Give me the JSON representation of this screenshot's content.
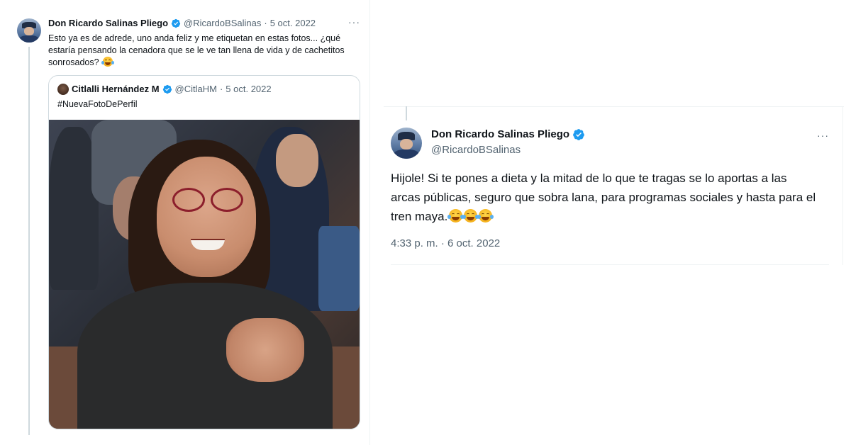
{
  "left_tweet": {
    "author_name": "Don Ricardo Salinas Pliego",
    "handle": "@RicardoBSalinas",
    "separator": "·",
    "date": "5 oct. 2022",
    "more_label": "···",
    "text": "Esto ya es de adrede, uno anda feliz y me etiquetan en estas fotos... ¿qué estaría pensando la cenadora que se le ve tan llena de vida y de cachetitos sonrosados?",
    "emoji": "face-with-tears-of-joy",
    "quoted_tweet": {
      "author_name": "Citlalli Hernández M",
      "handle": "@CitlaHM",
      "separator": "·",
      "date": "5 oct. 2022",
      "text": "#NuevaFotoDePerfil",
      "photo": "woman-smiling-red-glasses"
    }
  },
  "right_tweet": {
    "author_name": "Don Ricardo Salinas Pliego",
    "handle": "@RicardoBSalinas",
    "more_label": "···",
    "text": "Hijole! Si te pones a dieta y la mitad de lo que te tragas se lo aportas a las arcas públicas, seguro que sobra lana, para programas sociales y hasta para el tren maya.",
    "emoji_count": 3,
    "emoji": "face-with-tears-of-joy",
    "timestamp": "4:33 p. m. · 6 oct. 2022"
  },
  "colors": {
    "text_primary": "#0f1419",
    "text_muted": "#536471",
    "verified_blue": "#1d9bf0",
    "border": "#cfd9de",
    "divider": "#eff3f4"
  }
}
